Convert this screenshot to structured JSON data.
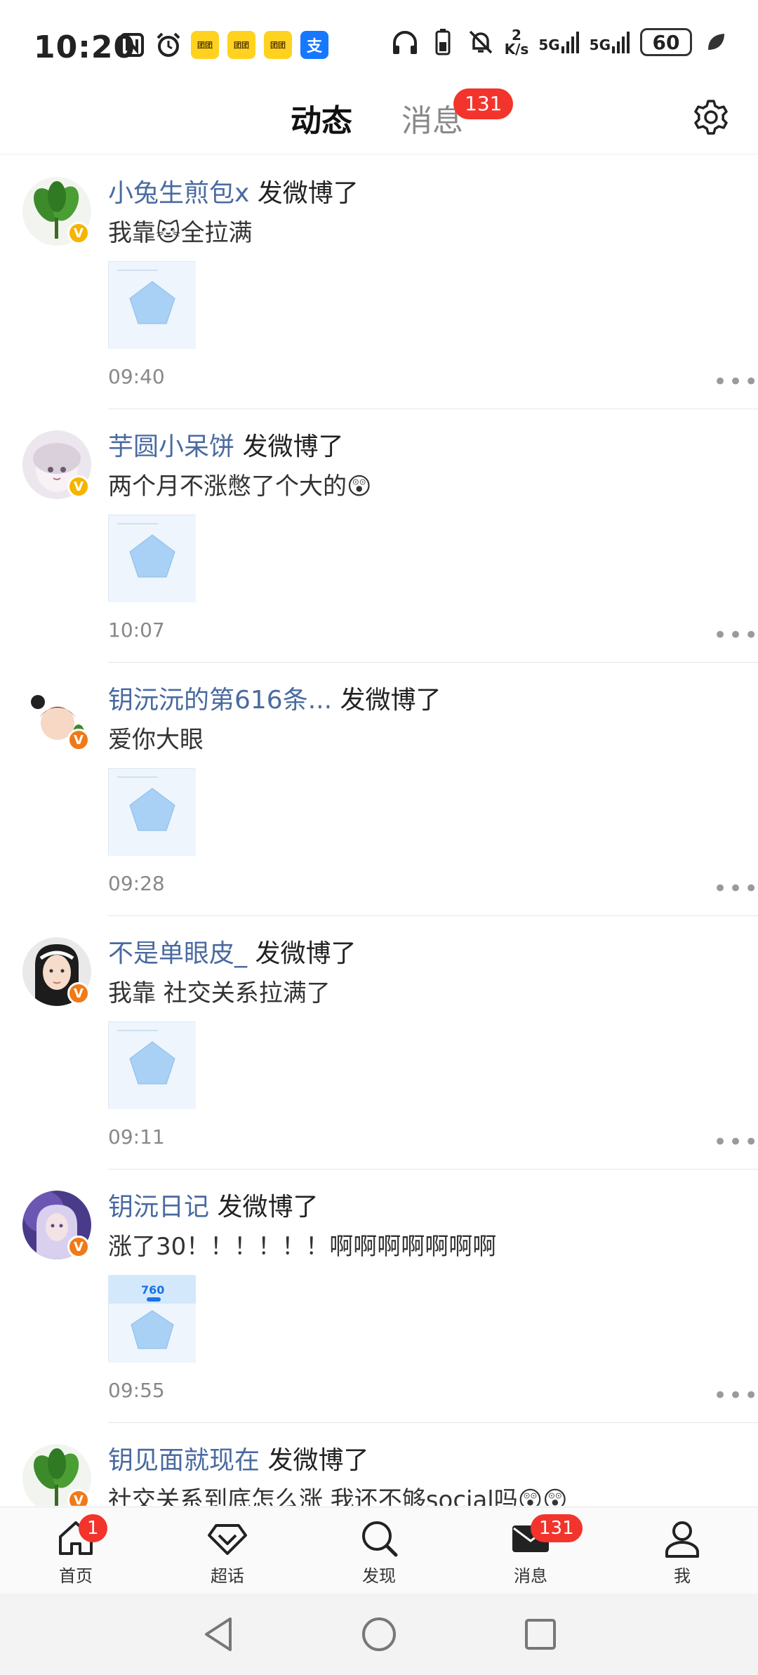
{
  "status_bar": {
    "time": "10:20",
    "app_icon_label": "团团",
    "alipay_label": "支",
    "net_speed_value": "2",
    "net_speed_unit": "K/s",
    "signal_1": "5G",
    "signal_2": "5G",
    "battery": "60"
  },
  "header": {
    "tab_active": "动态",
    "tab_inactive": "消息",
    "badge": "131"
  },
  "posts": [
    {
      "name": "小兔生煎包x",
      "action": "发微博了",
      "text": "我靠🐱全拉满",
      "time": "09:40",
      "verify_color": "#f5b400"
    },
    {
      "name": "芋圆小呆饼",
      "action": "发微博了",
      "text": "两个月不涨憋了个大的😲",
      "time": "10:07",
      "verify_color": "#f5b400"
    },
    {
      "name": "钥沅沅的第616条...",
      "action": "发微博了",
      "text": "爱你大眼",
      "time": "09:28",
      "verify_color": "#f07a18"
    },
    {
      "name": "不是单眼皮_",
      "action": "发微博了",
      "text": "我靠 社交关系拉满了",
      "time": "09:11",
      "verify_color": "#f07a18"
    },
    {
      "name": "钥沅日记",
      "action": "发微博了",
      "text": "涨了30！！！！！！啊啊啊啊啊啊啊",
      "time": "09:55",
      "verify_color": "#f07a18",
      "thumb_label": "760"
    },
    {
      "name": "钥见面就现在",
      "action": "发微博了",
      "text": "社交关系到底怎么涨 我还不够social吗😲😲",
      "time": "",
      "verify_color": "#f07a18"
    }
  ],
  "bottom_nav": {
    "home": "首页",
    "home_badge": "1",
    "super": "超话",
    "discover": "发现",
    "messages": "消息",
    "messages_badge": "131",
    "me": "我"
  },
  "colors": {
    "accent": "#ff9900",
    "badge": "#f2342c",
    "username": "#4a6aa0"
  }
}
